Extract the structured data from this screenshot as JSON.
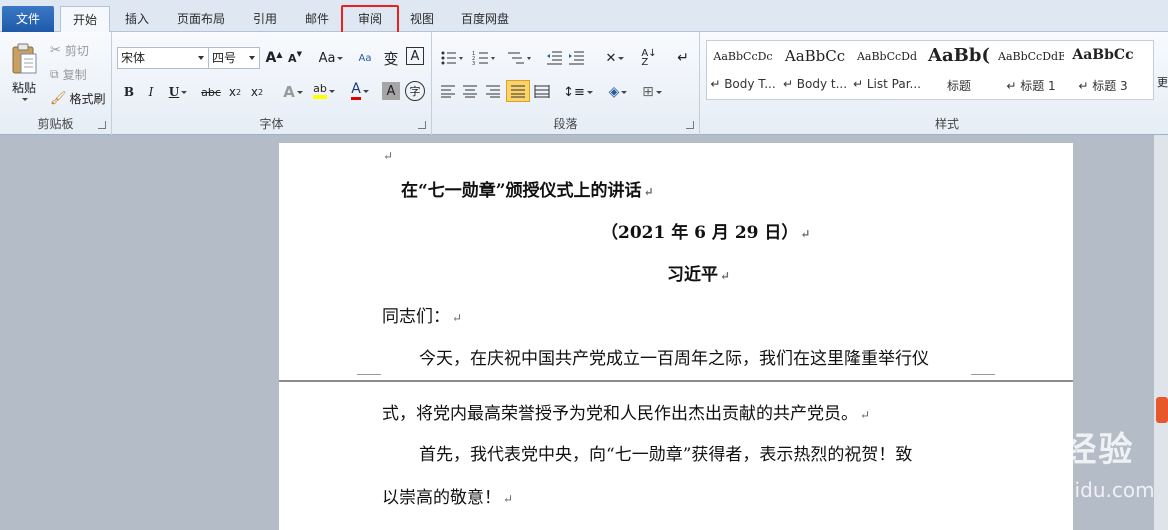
{
  "tabs": [
    {
      "label": "文件",
      "key": "file"
    },
    {
      "label": "开始",
      "key": "home"
    },
    {
      "label": "插入",
      "key": "insert"
    },
    {
      "label": "页面布局",
      "key": "layout"
    },
    {
      "label": "引用",
      "key": "references"
    },
    {
      "label": "邮件",
      "key": "mailings"
    },
    {
      "label": "审阅",
      "key": "review"
    },
    {
      "label": "视图",
      "key": "view"
    },
    {
      "label": "百度网盘",
      "key": "baidu"
    }
  ],
  "clipboard": {
    "paste": "粘贴",
    "cut": "剪切",
    "copy": "复制",
    "format_painter": "格式刷",
    "label": "剪贴板"
  },
  "font": {
    "name": "宋体",
    "size": "四号",
    "label": "字体",
    "aa": "Aa"
  },
  "paragraph": {
    "label": "段落"
  },
  "styles": {
    "label": "样式",
    "items": [
      {
        "sample": "AaBbCcDc",
        "name": "↵ Body T..."
      },
      {
        "sample": "AaBbCc",
        "name": "↵ Body t..."
      },
      {
        "sample": "AaBbCcDd",
        "name": "↵ List Par..."
      },
      {
        "sample": "AaBb(",
        "name": "标题"
      },
      {
        "sample": "AaBbCcDdE",
        "name": "↵ 标题 1"
      },
      {
        "sample": "AaBbCc",
        "name": "↵ 标题 3"
      }
    ],
    "more": "更"
  },
  "document": {
    "title": "在“七一勋章”颁授仪式上的讲话",
    "date": "（2021 年 6 月 29 日）",
    "author": "习近平",
    "salutation": "同志们：",
    "p1_line1": "今天，在庆祝中国共产党成立一百周年之际，我们在这里隆重举行仪",
    "p1_line2": "式，将党内最高荣誉授予为党和人民作出杰出贡献的共产党员。",
    "p2_line1": "首先，我代表党中央，向“七一勋章”获得者，表示热烈的祝贺！致",
    "p2_line2": "以崇高的敬意！",
    "para_mark": "↵"
  },
  "watermark": {
    "text": "Bai 经验",
    "url": "jingyan.baidu.com"
  }
}
